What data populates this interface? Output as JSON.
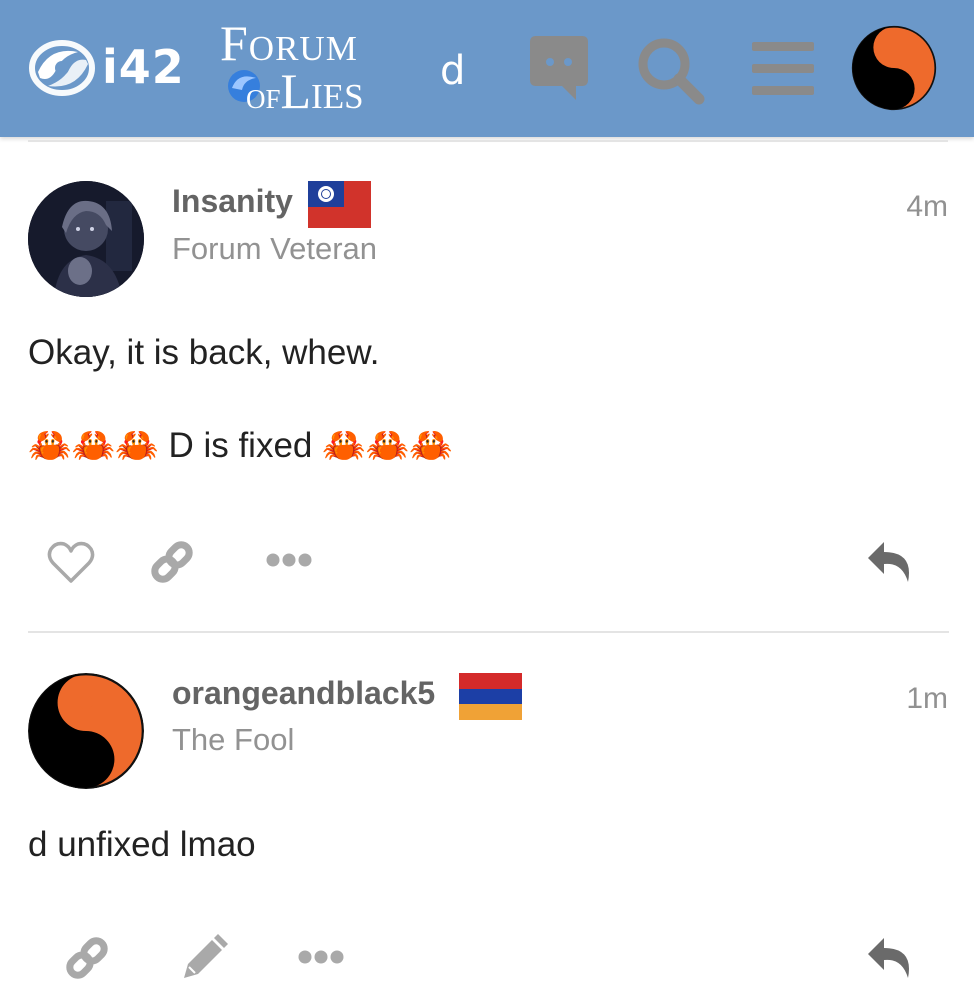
{
  "header": {
    "brand_i42": "i42",
    "brand_forum_line1": "Forum",
    "brand_forum_of": "of",
    "brand_forum_lies": "Lies",
    "topic_title": "d",
    "icons": [
      "chat-icon",
      "search-icon",
      "hamburger-menu-icon",
      "user-avatar-yin-yang"
    ],
    "background_color": "#6b98c9"
  },
  "posts": [
    {
      "username": "Insanity",
      "flag": "taiwan-flag",
      "user_title": "Forum Veteran",
      "time": "4m",
      "body": [
        "Okay, it is back, whew.",
        "🦀🦀🦀 D is fixed 🦀🦀🦀"
      ],
      "actions": [
        "like-heart-icon",
        "copy-link-icon",
        "more-options-icon",
        "reply-icon"
      ]
    },
    {
      "username": "orangeandblack5",
      "flag": "armenia-flag",
      "user_title": "The Fool",
      "time": "1m",
      "body": [
        "d unfixed lmao"
      ],
      "actions": [
        "copy-link-icon",
        "edit-pencil-icon",
        "more-options-icon",
        "reply-icon"
      ]
    }
  ],
  "colors": {
    "username": "#646464",
    "user_title": "#929292",
    "icon_gray": "#a9a9a9",
    "reply_icon": "#6a6a6a",
    "yin_yang_orange": "#ee6a2c"
  }
}
